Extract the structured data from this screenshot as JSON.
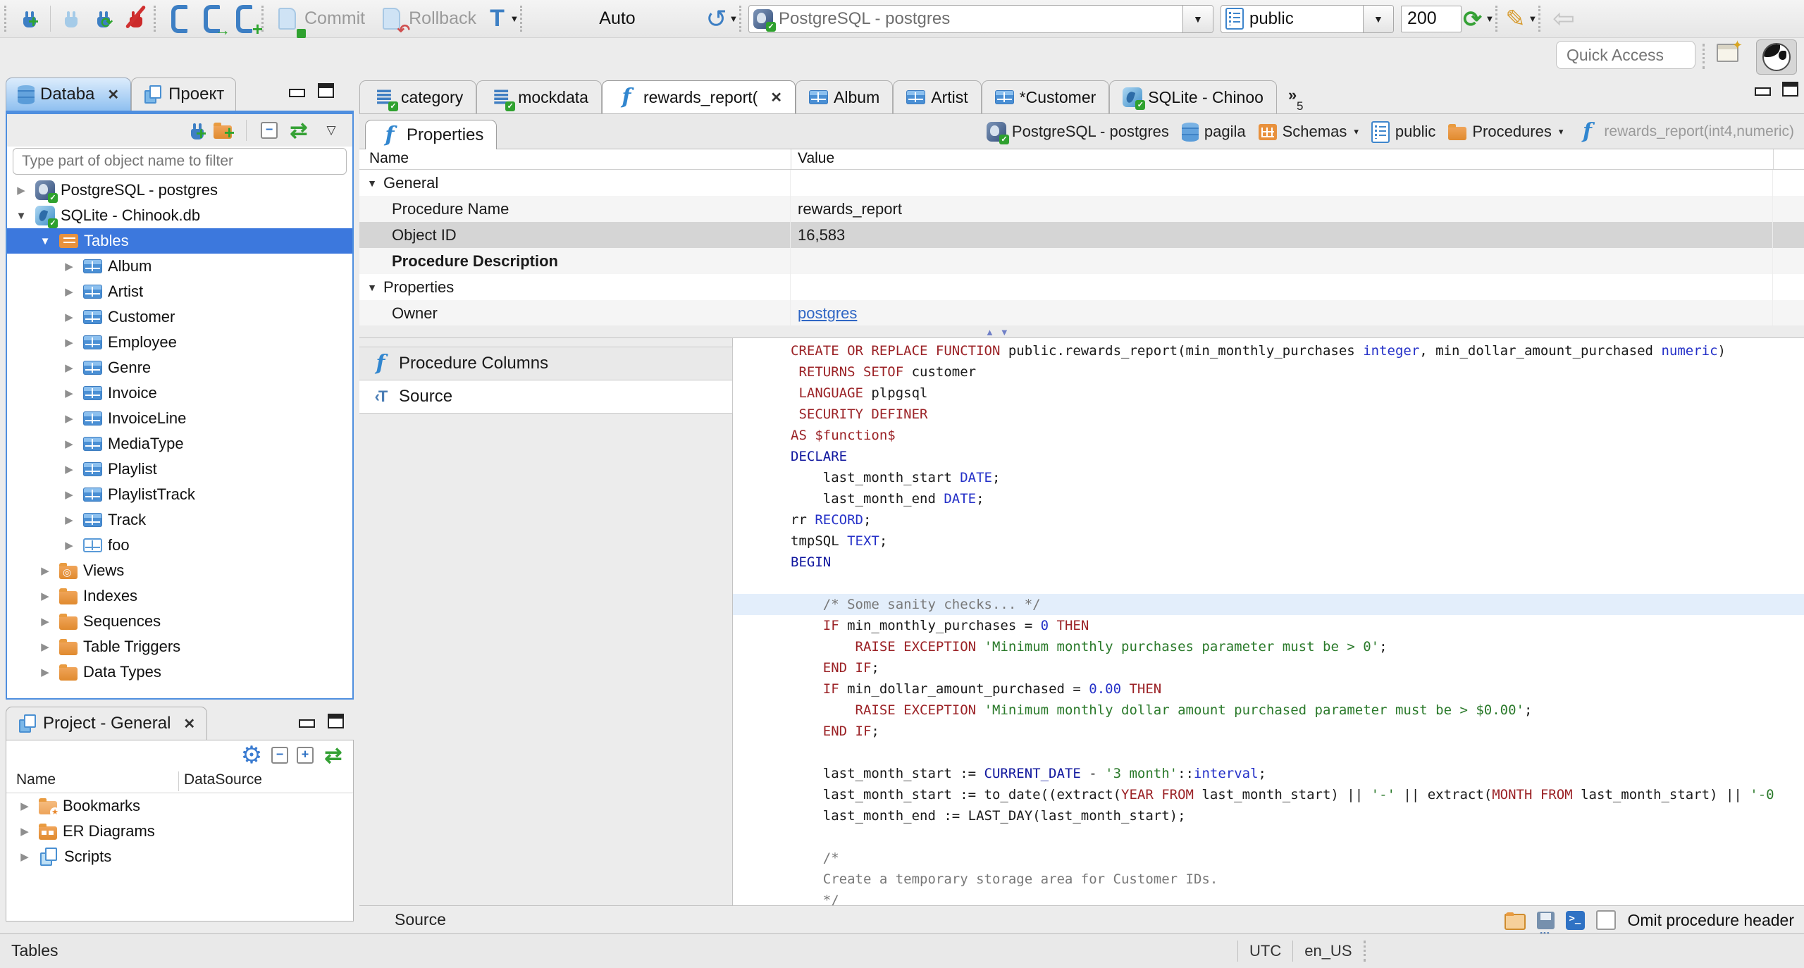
{
  "toolbar": {
    "commit": "Commit",
    "rollback": "Rollback",
    "auto": "Auto",
    "connection": "PostgreSQL - postgres",
    "schema": "public",
    "fetch_size": "200"
  },
  "quick_access": {
    "placeholder": "Quick Access"
  },
  "sidebar": {
    "tabs": [
      {
        "label": "Databa",
        "active": true
      },
      {
        "label": "Проект"
      }
    ],
    "filter_placeholder": "Type part of object name to filter",
    "tree": [
      {
        "label": "PostgreSQL - postgres",
        "icon": "postgres-db",
        "depth": 0,
        "arrow": "right"
      },
      {
        "label": "SQLite - Chinook.db",
        "icon": "sqlite-db",
        "depth": 0,
        "arrow": "down"
      },
      {
        "label": "Tables",
        "icon": "tables-folder",
        "depth": 1,
        "arrow": "down",
        "selected": true
      },
      {
        "label": "Album",
        "icon": "table",
        "depth": 2,
        "arrow": "right"
      },
      {
        "label": "Artist",
        "icon": "table",
        "depth": 2,
        "arrow": "right"
      },
      {
        "label": "Customer",
        "icon": "table",
        "depth": 2,
        "arrow": "right"
      },
      {
        "label": "Employee",
        "icon": "table",
        "depth": 2,
        "arrow": "right"
      },
      {
        "label": "Genre",
        "icon": "table",
        "depth": 2,
        "arrow": "right"
      },
      {
        "label": "Invoice",
        "icon": "table",
        "depth": 2,
        "arrow": "right"
      },
      {
        "label": "InvoiceLine",
        "icon": "table",
        "depth": 2,
        "arrow": "right"
      },
      {
        "label": "MediaType",
        "icon": "table",
        "depth": 2,
        "arrow": "right"
      },
      {
        "label": "Playlist",
        "icon": "table",
        "depth": 2,
        "arrow": "right"
      },
      {
        "label": "PlaylistTrack",
        "icon": "table",
        "depth": 2,
        "arrow": "right"
      },
      {
        "label": "Track",
        "icon": "table",
        "depth": 2,
        "arrow": "right"
      },
      {
        "label": "foo",
        "icon": "table-plain",
        "depth": 2,
        "arrow": "right"
      },
      {
        "label": "Views",
        "icon": "views-folder",
        "depth": 1,
        "arrow": "right"
      },
      {
        "label": "Indexes",
        "icon": "folder",
        "depth": 1,
        "arrow": "right"
      },
      {
        "label": "Sequences",
        "icon": "folder",
        "depth": 1,
        "arrow": "right"
      },
      {
        "label": "Table Triggers",
        "icon": "folder",
        "depth": 1,
        "arrow": "right"
      },
      {
        "label": "Data Types",
        "icon": "folder",
        "depth": 1,
        "arrow": "right"
      }
    ]
  },
  "project_panel": {
    "tab_label": "Project - General",
    "columns": [
      "Name",
      "DataSource"
    ],
    "items": [
      {
        "label": "Bookmarks",
        "icon": "folder-star"
      },
      {
        "label": "ER Diagrams",
        "icon": "folder-er"
      },
      {
        "label": "Scripts",
        "icon": "scripts"
      }
    ]
  },
  "editor": {
    "tabs": [
      {
        "label": "category",
        "icon": "sql-script"
      },
      {
        "label": "mockdata",
        "icon": "sql-script"
      },
      {
        "label": "rewards_report(",
        "icon": "function",
        "active": true,
        "closable": true
      },
      {
        "label": "Album",
        "icon": "table"
      },
      {
        "label": "Artist",
        "icon": "table"
      },
      {
        "label": "*Customer",
        "icon": "table"
      },
      {
        "label": "SQLite - Chinoo",
        "icon": "sqlite-db"
      }
    ],
    "overflow_count": "5",
    "subtab_label": "Properties"
  },
  "breadcrumb": [
    {
      "label": "PostgreSQL - postgres",
      "icon": "postgres-db"
    },
    {
      "label": "pagila",
      "icon": "database"
    },
    {
      "label": "Schemas",
      "icon": "schemas",
      "dropdown": true
    },
    {
      "label": "public",
      "icon": "schema-page"
    },
    {
      "label": "Procedures",
      "icon": "folder",
      "dropdown": true
    },
    {
      "label": "rewards_report(int4,numeric)",
      "icon": "function",
      "muted": true
    }
  ],
  "properties": {
    "columns": [
      "Name",
      "Value"
    ],
    "rows": [
      {
        "name": "General",
        "value": "",
        "group": true
      },
      {
        "name": "Procedure Name",
        "value": "rewards_report"
      },
      {
        "name": "Object ID",
        "value": "16,583",
        "selected": true
      },
      {
        "name": "Procedure Description",
        "value": "",
        "bold": true
      },
      {
        "name": "Properties",
        "value": "",
        "group": true
      },
      {
        "name": "Owner",
        "value": "postgres",
        "link": true
      }
    ]
  },
  "source_panel": {
    "items": [
      {
        "label": "Procedure Columns",
        "icon": "function"
      },
      {
        "label": "Source",
        "icon": "source",
        "selected": true
      }
    ],
    "status_label": "Source",
    "omit_label": "Omit procedure header"
  },
  "code": {
    "highlight_line": 12,
    "lines": [
      [
        [
          "r",
          "CREATE OR REPLACE FUNCTION"
        ],
        [
          "p",
          " public.rewards_report(min_monthly_purchases "
        ],
        [
          "b",
          "integer"
        ],
        [
          "p",
          ", min_dollar_amount_purchased "
        ],
        [
          "b",
          "numeric"
        ],
        [
          "p",
          ")"
        ]
      ],
      [
        [
          "p",
          " "
        ],
        [
          "r",
          "RETURNS SETOF"
        ],
        [
          "p",
          " customer"
        ]
      ],
      [
        [
          "p",
          " "
        ],
        [
          "r",
          "LANGUAGE"
        ],
        [
          "p",
          " plpgsql"
        ]
      ],
      [
        [
          "p",
          " "
        ],
        [
          "r",
          "SECURITY DEFINER"
        ]
      ],
      [
        [
          "r",
          "AS $function$"
        ]
      ],
      [
        [
          "n",
          "DECLARE"
        ]
      ],
      [
        [
          "p",
          "    last_month_start "
        ],
        [
          "b",
          "DATE"
        ],
        [
          "p",
          ";"
        ]
      ],
      [
        [
          "p",
          "    last_month_end "
        ],
        [
          "b",
          "DATE"
        ],
        [
          "p",
          ";"
        ]
      ],
      [
        [
          "p",
          "rr "
        ],
        [
          "b",
          "RECORD"
        ],
        [
          "p",
          ";"
        ]
      ],
      [
        [
          "p",
          "tmpSQL "
        ],
        [
          "b",
          "TEXT"
        ],
        [
          "p",
          ";"
        ]
      ],
      [
        [
          "n",
          "BEGIN"
        ]
      ],
      [],
      [
        [
          "c",
          "    /* Some sanity checks... */"
        ]
      ],
      [
        [
          "p",
          "    "
        ],
        [
          "r",
          "IF"
        ],
        [
          "p",
          " min_monthly_purchases = "
        ],
        [
          "b",
          "0"
        ],
        [
          "p",
          " "
        ],
        [
          "r",
          "THEN"
        ]
      ],
      [
        [
          "p",
          "        "
        ],
        [
          "r",
          "RAISE EXCEPTION"
        ],
        [
          "p",
          " "
        ],
        [
          "g",
          "'Minimum monthly purchases parameter must be > 0'"
        ],
        [
          "p",
          ";"
        ]
      ],
      [
        [
          "p",
          "    "
        ],
        [
          "r",
          "END IF"
        ],
        [
          "p",
          ";"
        ]
      ],
      [
        [
          "p",
          "    "
        ],
        [
          "r",
          "IF"
        ],
        [
          "p",
          " min_dollar_amount_purchased = "
        ],
        [
          "b",
          "0.00"
        ],
        [
          "p",
          " "
        ],
        [
          "r",
          "THEN"
        ]
      ],
      [
        [
          "p",
          "        "
        ],
        [
          "r",
          "RAISE EXCEPTION"
        ],
        [
          "p",
          " "
        ],
        [
          "g",
          "'Minimum monthly dollar amount purchased parameter must be > $0.00'"
        ],
        [
          "p",
          ";"
        ]
      ],
      [
        [
          "p",
          "    "
        ],
        [
          "r",
          "END IF"
        ],
        [
          "p",
          ";"
        ]
      ],
      [],
      [
        [
          "p",
          "    last_month_start := "
        ],
        [
          "n",
          "CURRENT_DATE"
        ],
        [
          "p",
          " - "
        ],
        [
          "g",
          "'3 month'"
        ],
        [
          "p",
          "::"
        ],
        [
          "b",
          "interval"
        ],
        [
          "p",
          ";"
        ]
      ],
      [
        [
          "p",
          "    last_month_start := to_date((extract("
        ],
        [
          "r",
          "YEAR FROM"
        ],
        [
          "p",
          " last_month_start) || "
        ],
        [
          "g",
          "'-'"
        ],
        [
          "p",
          " || extract("
        ],
        [
          "r",
          "MONTH FROM"
        ],
        [
          "p",
          " last_month_start) || "
        ],
        [
          "g",
          "'-0"
        ]
      ],
      [
        [
          "p",
          "    last_month_end := LAST_DAY(last_month_start);"
        ]
      ],
      [],
      [
        [
          "c",
          "    /*"
        ]
      ],
      [
        [
          "c",
          "    Create a temporary storage area for Customer IDs."
        ]
      ],
      [
        [
          "c",
          "    */"
        ]
      ]
    ]
  },
  "statusbar": {
    "left": "Tables",
    "timezone": "UTC",
    "locale": "en_US"
  }
}
